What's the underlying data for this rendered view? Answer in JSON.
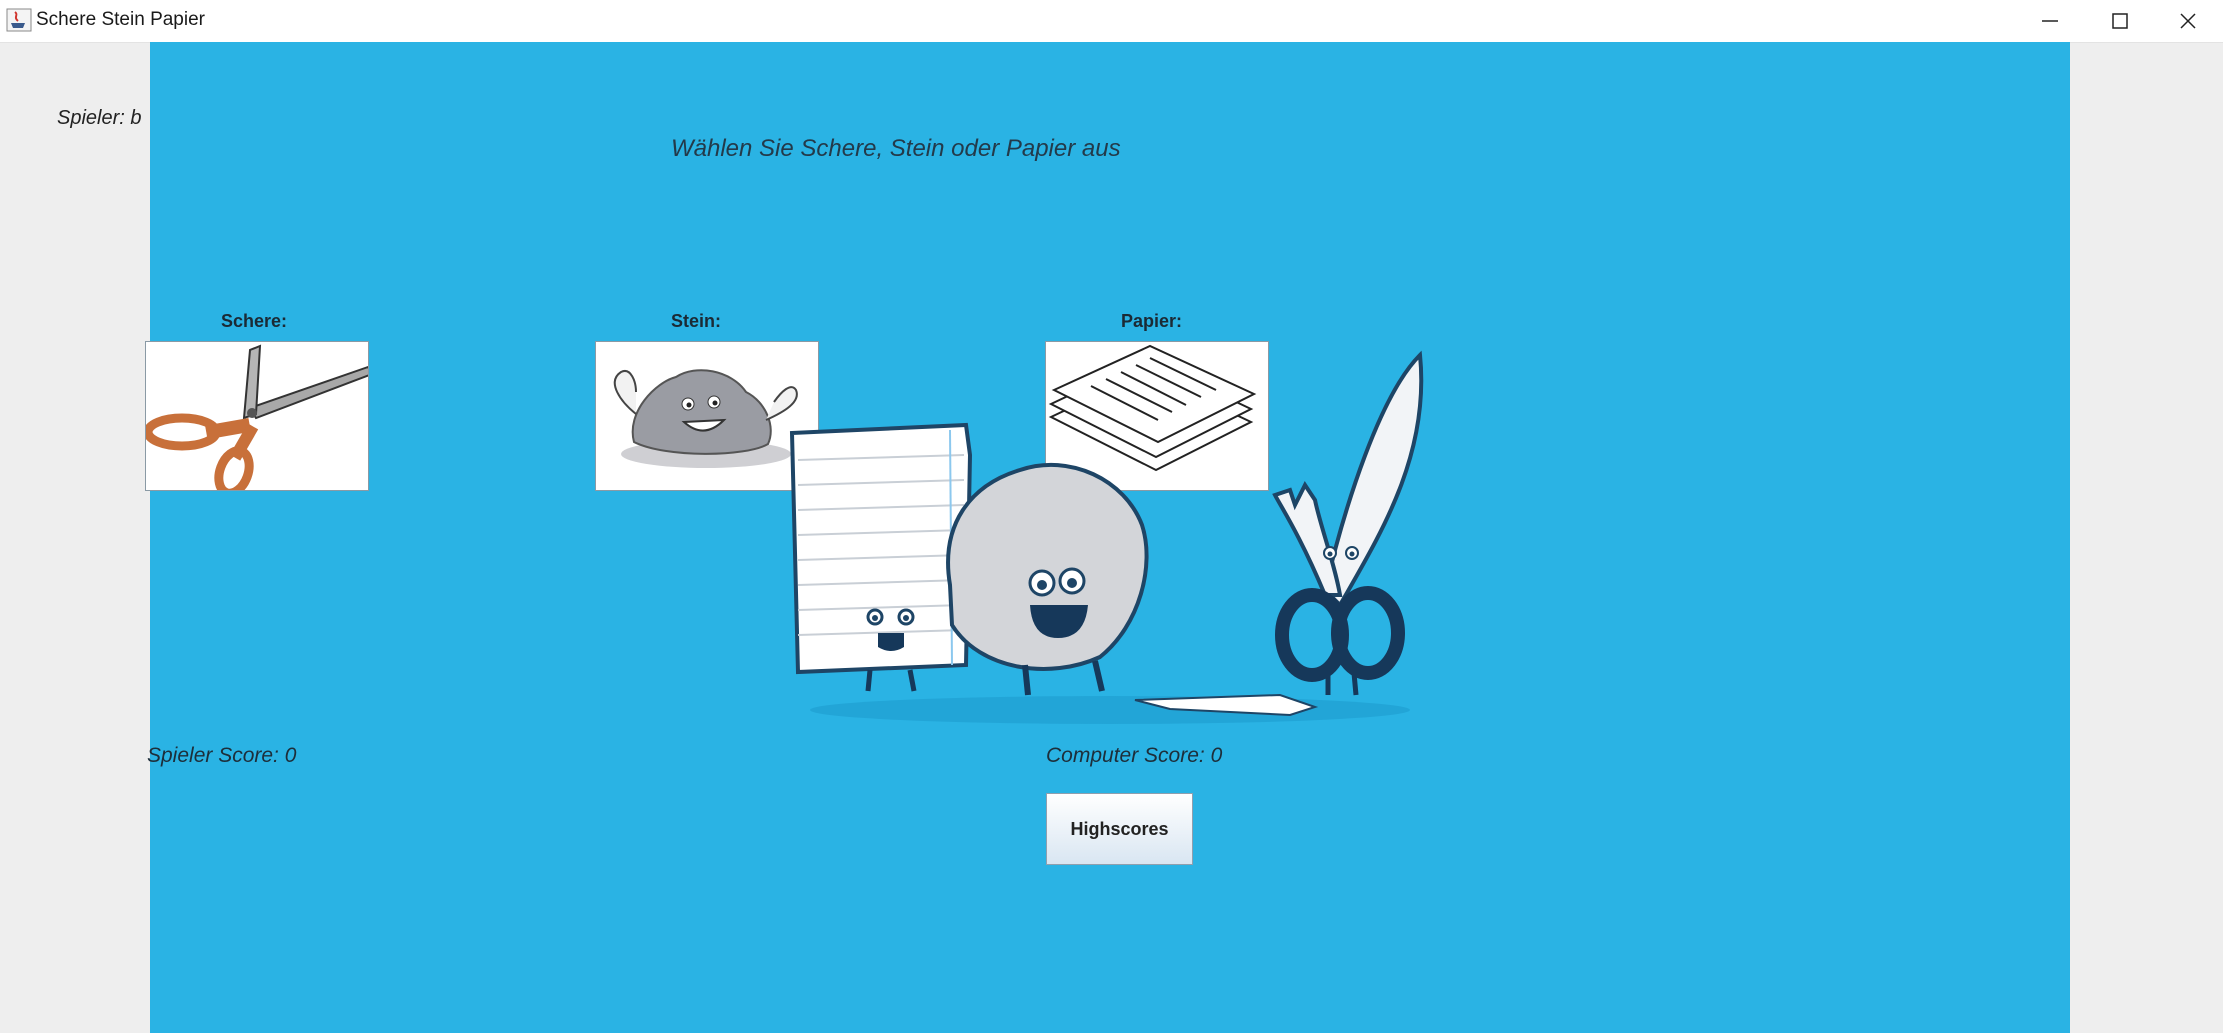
{
  "window": {
    "title": "Schere Stein Papier",
    "controls": [
      "minimize-icon",
      "maximize-icon",
      "close-icon"
    ]
  },
  "game": {
    "player_label": "Spieler: b",
    "instruction": "Wählen Sie Schere, Stein oder Papier aus",
    "choices": [
      {
        "label": "Schere:",
        "icon": "scissors-icon"
      },
      {
        "label": "Stein:",
        "icon": "rock-icon"
      },
      {
        "label": "Papier:",
        "icon": "paper-icon"
      }
    ],
    "player_score": "Spieler Score: 0",
    "computer_score": "Computer Score: 0",
    "highscores_label": "Highscores"
  },
  "colors": {
    "background": "#2ab3e4",
    "window_frame": "#eeeeee"
  }
}
